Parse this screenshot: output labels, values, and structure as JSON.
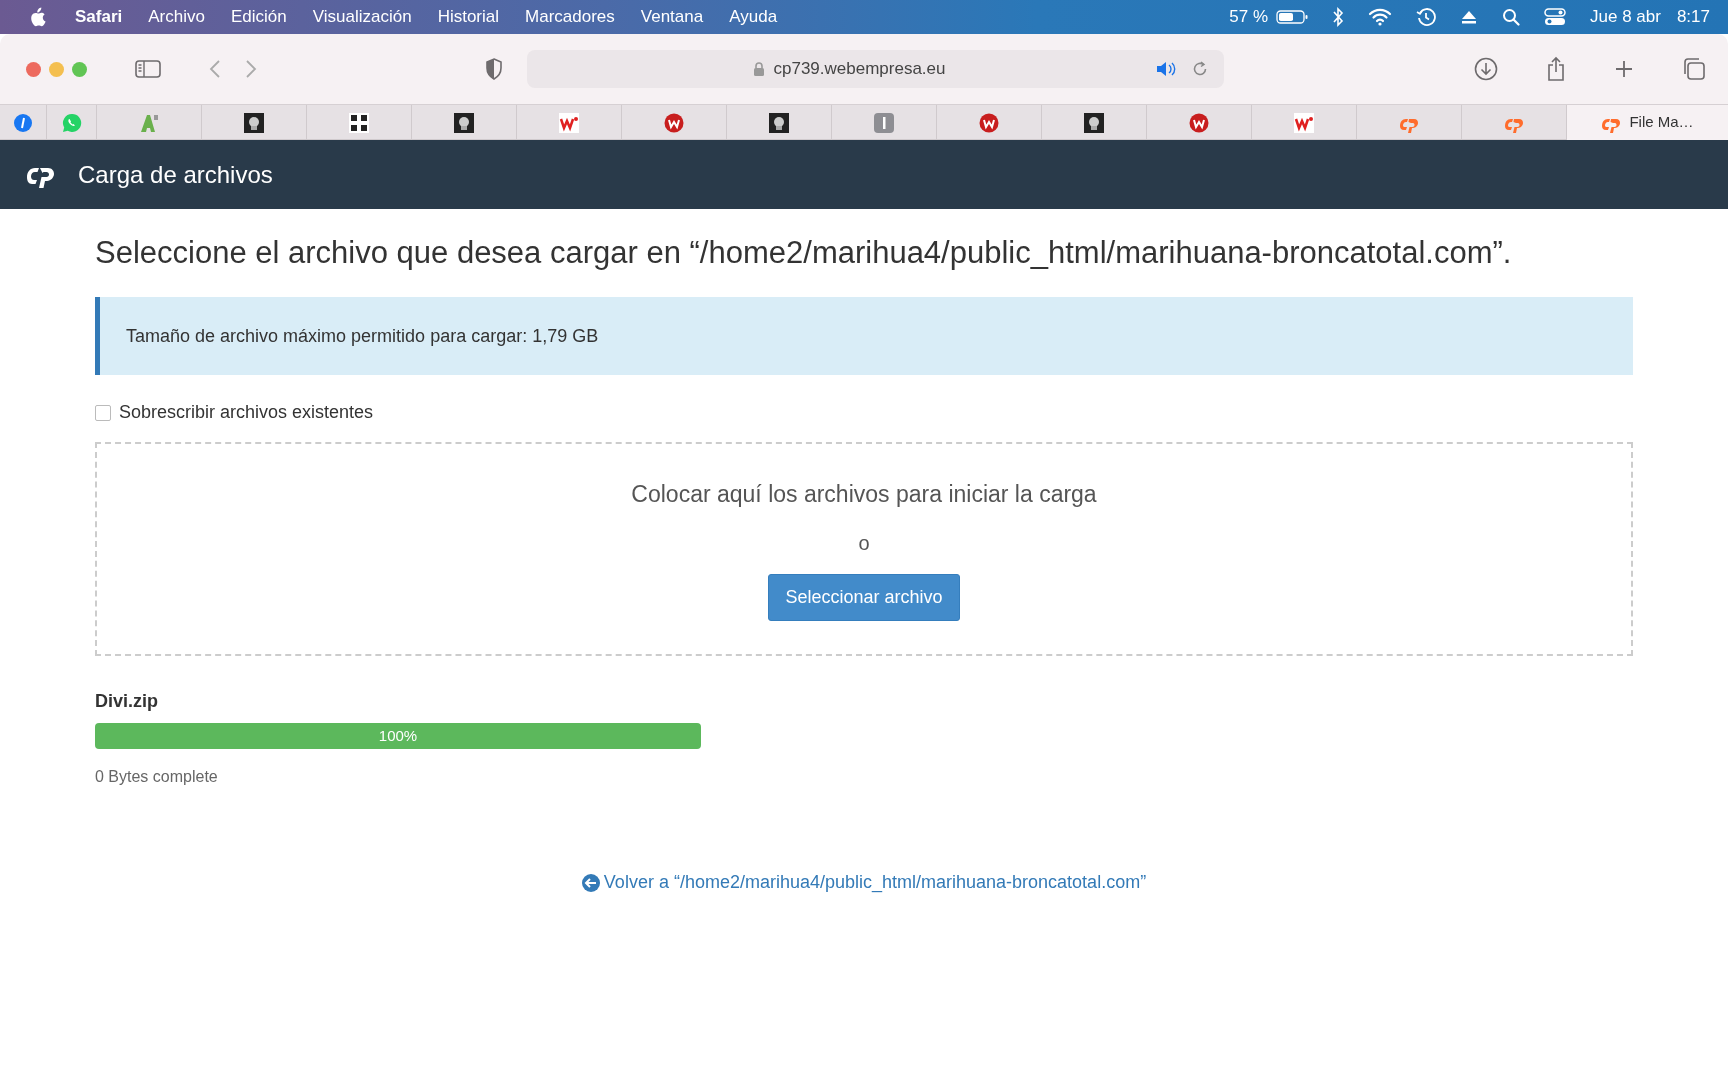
{
  "menu_bar": {
    "app": "Safari",
    "items": [
      "Archivo",
      "Edición",
      "Visualización",
      "Historial",
      "Marcadores",
      "Ventana",
      "Ayuda"
    ],
    "battery": "57 %",
    "date": "Jue 8 abr",
    "time": "8:17"
  },
  "toolbar": {
    "url": "cp739.webempresa.eu"
  },
  "tabs": [
    {
      "kind": "blue",
      "selected": false
    },
    {
      "kind": "chat",
      "selected": false
    },
    {
      "kind": "letter",
      "selected": false
    },
    {
      "kind": "photo",
      "selected": false
    },
    {
      "kind": "grid",
      "selected": false
    },
    {
      "kind": "photo",
      "selected": false
    },
    {
      "kind": "brand",
      "selected": false
    },
    {
      "kind": "mark",
      "selected": false
    },
    {
      "kind": "photo",
      "selected": false
    },
    {
      "kind": "square",
      "selected": false
    },
    {
      "kind": "mark",
      "selected": false
    },
    {
      "kind": "photo",
      "selected": false
    },
    {
      "kind": "mark",
      "selected": false
    },
    {
      "kind": "brand",
      "selected": false
    },
    {
      "kind": "cp",
      "selected": false
    },
    {
      "kind": "cp",
      "selected": false
    },
    {
      "kind": "cp",
      "label": "File Ma…",
      "selected": true
    }
  ],
  "header": {
    "title": "Carga de archivos"
  },
  "heading": "Seleccione el archivo que desea cargar en “/home2/marihua4/public_html/marihuana-broncatotal.com”.",
  "alert": "Tamaño de archivo máximo permitido para cargar: 1,79 GB",
  "overwrite": {
    "label": "Sobrescribir archivos existentes",
    "checked": false
  },
  "dropzone": {
    "prompt": "Colocar aquí los archivos para iniciar la carga",
    "or": "o",
    "button": "Seleccionar archivo"
  },
  "uploads": [
    {
      "file": "Divi.zip",
      "level": 1,
      "percent": "100%",
      "status": "0 Bytes complete"
    }
  ],
  "back_link": "Volver a “/home2/marihua4/public_html/marihuana-broncatotal.com”"
}
